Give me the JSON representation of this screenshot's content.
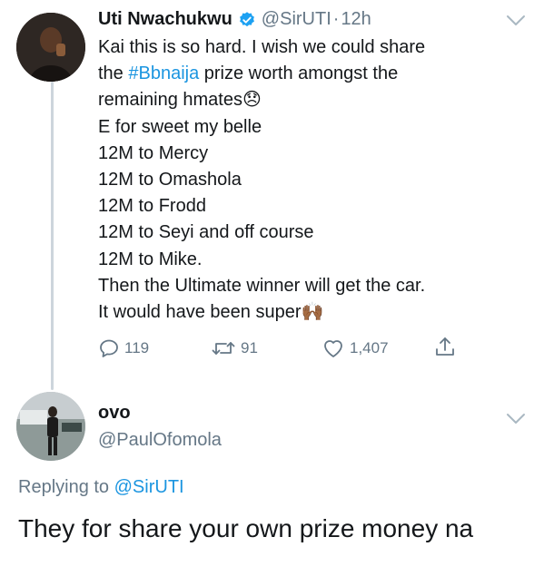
{
  "tweet": {
    "author_name": "Uti Nwachukwu",
    "verified_icon": "verified-badge-icon",
    "handle": "@SirUTI",
    "separator": "·",
    "time": "12h",
    "lines": [
      {
        "before": "Kai this is so hard.  I wish we could share",
        "hashtag": "",
        "after": "",
        "emoji": ""
      },
      {
        "before": "the ",
        "hashtag": "#Bbnaija",
        "after": " prize worth amongst the",
        "emoji": ""
      },
      {
        "before": "remaining hmates",
        "hashtag": "",
        "after": "",
        "emoji": "😞"
      },
      {
        "before": "E for sweet my belle",
        "hashtag": "",
        "after": "",
        "emoji": ""
      },
      {
        "before": "12M to Mercy",
        "hashtag": "",
        "after": "",
        "emoji": ""
      },
      {
        "before": "12M to Omashola",
        "hashtag": "",
        "after": "",
        "emoji": ""
      },
      {
        "before": "12M to Frodd",
        "hashtag": "",
        "after": "",
        "emoji": ""
      },
      {
        "before": "12M to Seyi and off course",
        "hashtag": "",
        "after": "",
        "emoji": ""
      },
      {
        "before": "12M to Mike.",
        "hashtag": "",
        "after": "",
        "emoji": ""
      },
      {
        "before": "Then the Ultimate winner will get the car.",
        "hashtag": "",
        "after": "",
        "emoji": ""
      },
      {
        "before": "It would have been super",
        "hashtag": "",
        "after": "",
        "emoji": "🙌🏾"
      }
    ],
    "replies": "119",
    "retweets": "91",
    "likes": "1,407"
  },
  "reply": {
    "author_name": "ovo",
    "handle": "@PaulOfomola",
    "replying_prefix": "Replying to",
    "replying_to": "@SirUTI",
    "text": "They for share your own prize money na"
  },
  "colors": {
    "accent": "#1b95e0",
    "muted": "#657786",
    "text": "#14171a"
  }
}
